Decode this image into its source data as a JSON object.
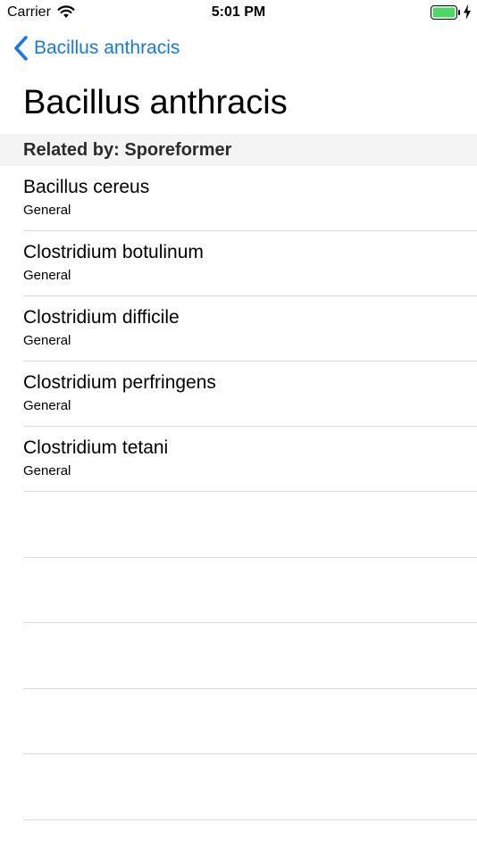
{
  "status_bar": {
    "carrier": "Carrier",
    "time": "5:01 PM",
    "battery_color": "#4cd964",
    "icons": [
      "wifi-icon",
      "battery-icon",
      "charging-icon"
    ]
  },
  "nav": {
    "back_label": "Bacillus anthracis",
    "back_icon": "chevron-left-icon",
    "accent_color": "#1677f2"
  },
  "page": {
    "title": "Bacillus anthracis"
  },
  "section": {
    "header": "Related by: Sporeformer"
  },
  "items": [
    {
      "title": "Bacillus cereus",
      "subtitle": "General"
    },
    {
      "title": "Clostridium botulinum",
      "subtitle": "General"
    },
    {
      "title": "Clostridium difficile",
      "subtitle": "General"
    },
    {
      "title": "Clostridium perfringens",
      "subtitle": "General"
    },
    {
      "title": "Clostridium tetani",
      "subtitle": "General"
    }
  ]
}
